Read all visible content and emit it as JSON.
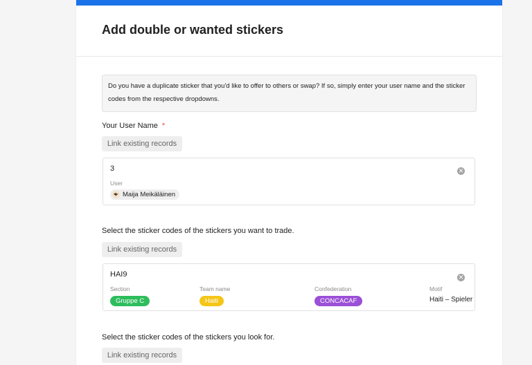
{
  "form": {
    "title": "Add double or wanted stickers",
    "description": "Do you have a duplicate sticker that you'd like to offer to others or swap? If so, simply enter your user name and the sticker codes from the respective dropdowns.",
    "accent_color": "#1a73e8"
  },
  "user_field": {
    "label": "Your User Name",
    "required_mark": "*",
    "link_button": "Link existing records",
    "record": {
      "title": "3",
      "user_label": "User",
      "user_name": "Maija Meikäläinen"
    }
  },
  "trade_field": {
    "label": "Select the sticker codes of the stickers you want to trade.",
    "link_button": "Link existing records",
    "record": {
      "title": "HAI9",
      "columns": {
        "section_label": "Section",
        "team_label": "Team name",
        "confederation_label": "Confederation",
        "motif_label": "Motif"
      },
      "values": {
        "section": "Gruppe C",
        "section_color": "#2ebd5c",
        "team": "Haiti",
        "team_color": "#f5c518",
        "confederation": "CONCACAF",
        "confederation_color": "#9b4fd6",
        "motif": "Haiti – Spieler"
      }
    }
  },
  "wanted_field": {
    "label": "Select the sticker codes of the stickers you look for.",
    "link_button": "Link existing records"
  },
  "icons": {
    "remove": "close-icon",
    "avatar": "user-avatar-icon"
  }
}
